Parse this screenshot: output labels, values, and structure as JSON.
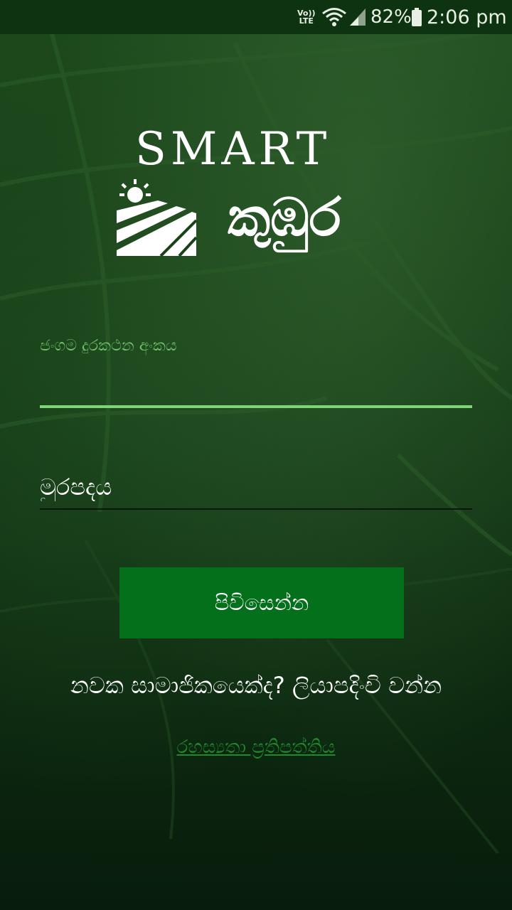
{
  "status_bar": {
    "volte_top": "Vo))",
    "volte_bottom": "LTE",
    "battery": "82%",
    "time": "2:06 pm",
    "icons": [
      "volte-icon",
      "wifi-icon",
      "signal-icon",
      "battery-icon"
    ]
  },
  "logo": {
    "smart": "SMART",
    "name": "කුඹුර",
    "icon": "sun-field-icon"
  },
  "login": {
    "phone_label": "ජංගම දුරකථන අංකය",
    "phone_value": "",
    "password_placeholder": "මුරපදය",
    "login_button": "පිවිසෙන්න",
    "register_prompt": "නවක සාමාජිකයෙක්ද?",
    "register_link": "ලියාපදිංචි වන්න",
    "privacy_link": "රහස්‍යතා ප්‍රතිපත්තිය"
  },
  "colors": {
    "status_bar": "#0e3310",
    "accent_green": "#7cd676",
    "button_green": "#05701b",
    "link_green": "#1f8a2a"
  }
}
